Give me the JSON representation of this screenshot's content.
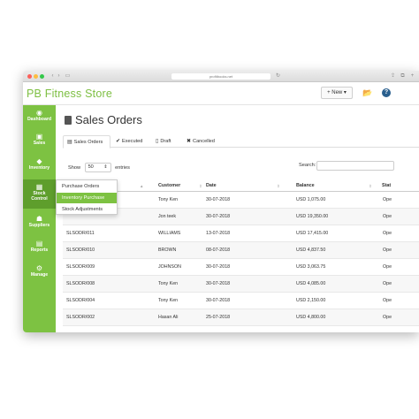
{
  "browser": {
    "url": "profitbooks.net",
    "back": "‹",
    "forward": "›",
    "sidebar_toggle": "▭",
    "reload": "↻",
    "share": "⇪",
    "duplicate": "⧉",
    "new_tab": "+"
  },
  "app": {
    "title": "PB Fitness Store",
    "new_button": "+ New ▾",
    "folder_icon": "📂",
    "help_icon": "?"
  },
  "sidebar": {
    "items": [
      {
        "label": "Dashboard",
        "icon": "◉"
      },
      {
        "label": "Sales",
        "icon": "▣"
      },
      {
        "label": "Inventory",
        "icon": "◆"
      },
      {
        "label": "Stock",
        "label2": "Control",
        "icon": "▦"
      },
      {
        "label": "Suppliers",
        "icon": "☗"
      },
      {
        "label": "Reports",
        "icon": "▤"
      },
      {
        "label": "Manage",
        "icon": "⚙"
      }
    ]
  },
  "page": {
    "title": "Sales Orders",
    "tabs": [
      {
        "label": "Sales Orders",
        "icon": "▤"
      },
      {
        "label": "Executed",
        "icon": "✔"
      },
      {
        "label": "Draft",
        "icon": "▯"
      },
      {
        "label": "Cancelled",
        "icon": "✖"
      }
    ],
    "show_label": "Show",
    "show_value": "50",
    "entries_label": "entries",
    "search_label": "Search:"
  },
  "table": {
    "columns": [
      "Customer",
      "Date",
      "Balance",
      "Stat"
    ],
    "rows": [
      {
        "id": "",
        "customer": "Tony Ken",
        "date": "30-07-2018",
        "balance": "USD 1,075.00",
        "status": "Ope"
      },
      {
        "id": "",
        "customer": "Jon teek",
        "date": "30-07-2018",
        "balance": "USD 19,350.00",
        "status": "Ope"
      },
      {
        "id": "SLSODR/011",
        "customer": "WILLIAMS",
        "date": "13-07-2018",
        "balance": "USD 17,415.00",
        "status": "Ope"
      },
      {
        "id": "SLSODR/010",
        "customer": "BROWN",
        "date": "08-07-2018",
        "balance": "USD 4,837.50",
        "status": "Ope"
      },
      {
        "id": "SLSODR/009",
        "customer": "JOHNSON",
        "date": "30-07-2018",
        "balance": "USD 3,063.75",
        "status": "Ope"
      },
      {
        "id": "SLSODR/008",
        "customer": "Tony Ken",
        "date": "30-07-2018",
        "balance": "USD 4,085.00",
        "status": "Ope"
      },
      {
        "id": "SLSODR/004",
        "customer": "Tony Ken",
        "date": "30-07-2018",
        "balance": "USD 2,150.00",
        "status": "Ope"
      },
      {
        "id": "SLSODR/002",
        "customer": "Hasan Ali",
        "date": "25-07-2018",
        "balance": "USD 4,800.00",
        "status": "Ope"
      }
    ]
  },
  "dropdown": {
    "items": [
      "Purchase Orders",
      "Inventory Purchase",
      "Stock Adjustments"
    ]
  }
}
